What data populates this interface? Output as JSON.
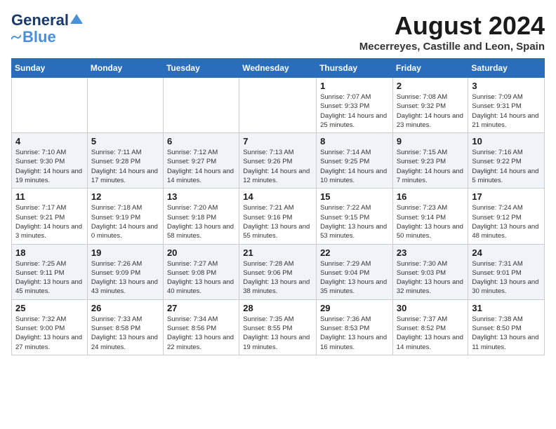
{
  "logo": {
    "text1": "General",
    "text2": "Blue"
  },
  "title": "August 2024",
  "subtitle": "Mecerreyes, Castille and Leon, Spain",
  "headers": [
    "Sunday",
    "Monday",
    "Tuesday",
    "Wednesday",
    "Thursday",
    "Friday",
    "Saturday"
  ],
  "weeks": [
    [
      {
        "day": "",
        "info": ""
      },
      {
        "day": "",
        "info": ""
      },
      {
        "day": "",
        "info": ""
      },
      {
        "day": "",
        "info": ""
      },
      {
        "day": "1",
        "info": "Sunrise: 7:07 AM\nSunset: 9:33 PM\nDaylight: 14 hours and 25 minutes."
      },
      {
        "day": "2",
        "info": "Sunrise: 7:08 AM\nSunset: 9:32 PM\nDaylight: 14 hours and 23 minutes."
      },
      {
        "day": "3",
        "info": "Sunrise: 7:09 AM\nSunset: 9:31 PM\nDaylight: 14 hours and 21 minutes."
      }
    ],
    [
      {
        "day": "4",
        "info": "Sunrise: 7:10 AM\nSunset: 9:30 PM\nDaylight: 14 hours and 19 minutes."
      },
      {
        "day": "5",
        "info": "Sunrise: 7:11 AM\nSunset: 9:28 PM\nDaylight: 14 hours and 17 minutes."
      },
      {
        "day": "6",
        "info": "Sunrise: 7:12 AM\nSunset: 9:27 PM\nDaylight: 14 hours and 14 minutes."
      },
      {
        "day": "7",
        "info": "Sunrise: 7:13 AM\nSunset: 9:26 PM\nDaylight: 14 hours and 12 minutes."
      },
      {
        "day": "8",
        "info": "Sunrise: 7:14 AM\nSunset: 9:25 PM\nDaylight: 14 hours and 10 minutes."
      },
      {
        "day": "9",
        "info": "Sunrise: 7:15 AM\nSunset: 9:23 PM\nDaylight: 14 hours and 7 minutes."
      },
      {
        "day": "10",
        "info": "Sunrise: 7:16 AM\nSunset: 9:22 PM\nDaylight: 14 hours and 5 minutes."
      }
    ],
    [
      {
        "day": "11",
        "info": "Sunrise: 7:17 AM\nSunset: 9:21 PM\nDaylight: 14 hours and 3 minutes."
      },
      {
        "day": "12",
        "info": "Sunrise: 7:18 AM\nSunset: 9:19 PM\nDaylight: 14 hours and 0 minutes."
      },
      {
        "day": "13",
        "info": "Sunrise: 7:20 AM\nSunset: 9:18 PM\nDaylight: 13 hours and 58 minutes."
      },
      {
        "day": "14",
        "info": "Sunrise: 7:21 AM\nSunset: 9:16 PM\nDaylight: 13 hours and 55 minutes."
      },
      {
        "day": "15",
        "info": "Sunrise: 7:22 AM\nSunset: 9:15 PM\nDaylight: 13 hours and 53 minutes."
      },
      {
        "day": "16",
        "info": "Sunrise: 7:23 AM\nSunset: 9:14 PM\nDaylight: 13 hours and 50 minutes."
      },
      {
        "day": "17",
        "info": "Sunrise: 7:24 AM\nSunset: 9:12 PM\nDaylight: 13 hours and 48 minutes."
      }
    ],
    [
      {
        "day": "18",
        "info": "Sunrise: 7:25 AM\nSunset: 9:11 PM\nDaylight: 13 hours and 45 minutes."
      },
      {
        "day": "19",
        "info": "Sunrise: 7:26 AM\nSunset: 9:09 PM\nDaylight: 13 hours and 43 minutes."
      },
      {
        "day": "20",
        "info": "Sunrise: 7:27 AM\nSunset: 9:08 PM\nDaylight: 13 hours and 40 minutes."
      },
      {
        "day": "21",
        "info": "Sunrise: 7:28 AM\nSunset: 9:06 PM\nDaylight: 13 hours and 38 minutes."
      },
      {
        "day": "22",
        "info": "Sunrise: 7:29 AM\nSunset: 9:04 PM\nDaylight: 13 hours and 35 minutes."
      },
      {
        "day": "23",
        "info": "Sunrise: 7:30 AM\nSunset: 9:03 PM\nDaylight: 13 hours and 32 minutes."
      },
      {
        "day": "24",
        "info": "Sunrise: 7:31 AM\nSunset: 9:01 PM\nDaylight: 13 hours and 30 minutes."
      }
    ],
    [
      {
        "day": "25",
        "info": "Sunrise: 7:32 AM\nSunset: 9:00 PM\nDaylight: 13 hours and 27 minutes."
      },
      {
        "day": "26",
        "info": "Sunrise: 7:33 AM\nSunset: 8:58 PM\nDaylight: 13 hours and 24 minutes."
      },
      {
        "day": "27",
        "info": "Sunrise: 7:34 AM\nSunset: 8:56 PM\nDaylight: 13 hours and 22 minutes."
      },
      {
        "day": "28",
        "info": "Sunrise: 7:35 AM\nSunset: 8:55 PM\nDaylight: 13 hours and 19 minutes."
      },
      {
        "day": "29",
        "info": "Sunrise: 7:36 AM\nSunset: 8:53 PM\nDaylight: 13 hours and 16 minutes."
      },
      {
        "day": "30",
        "info": "Sunrise: 7:37 AM\nSunset: 8:52 PM\nDaylight: 13 hours and 14 minutes."
      },
      {
        "day": "31",
        "info": "Sunrise: 7:38 AM\nSunset: 8:50 PM\nDaylight: 13 hours and 11 minutes."
      }
    ]
  ]
}
